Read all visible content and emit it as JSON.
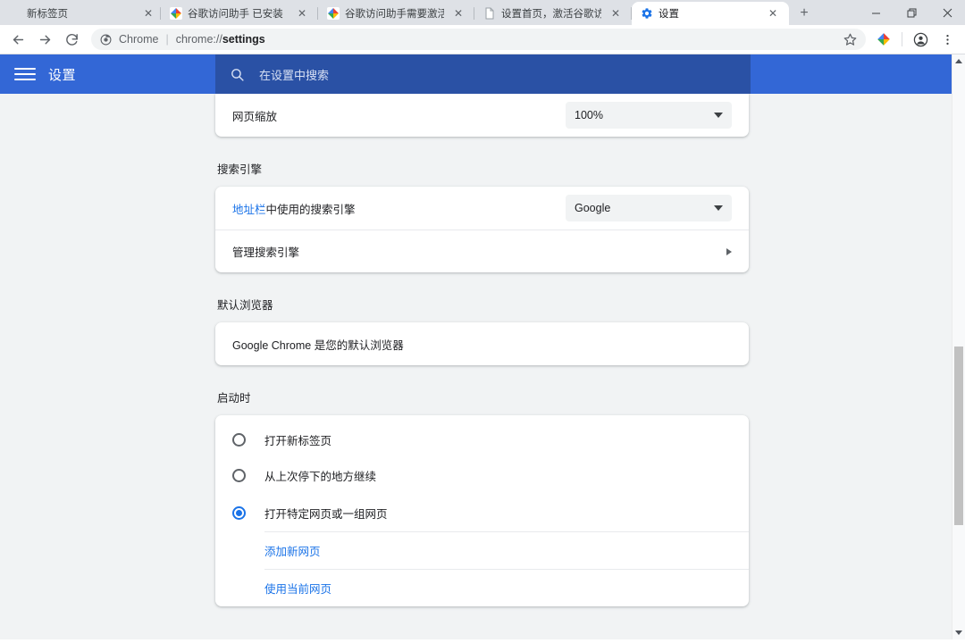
{
  "browser": {
    "tabs": [
      {
        "title": "新标签页",
        "favicon": "none",
        "active": false
      },
      {
        "title": "谷歌访问助手 已安装",
        "favicon": "google-pinwheel",
        "active": false
      },
      {
        "title": "谷歌访问助手需要激活",
        "favicon": "google-pinwheel",
        "active": false
      },
      {
        "title": "设置首页，激活谷歌访问⋯",
        "favicon": "page-icon",
        "active": false
      },
      {
        "title": "设置",
        "favicon": "gear-icon",
        "active": true
      }
    ],
    "new_tab_label": "+",
    "close_label": "✕",
    "window_controls": {
      "minimize": "—",
      "maximize": "❐",
      "close": "✕"
    },
    "omnibox": {
      "scheme_label": "Chrome",
      "separator": "|",
      "url_prefix": "chrome://",
      "url_bold": "settings"
    },
    "toolbar_icons": {
      "back": "back-arrow-icon",
      "forward": "forward-arrow-icon",
      "reload": "reload-icon",
      "site_info": "chrome-info-icon",
      "bookmark": "star-icon",
      "extension": "google-pinwheel-extension-icon",
      "profile": "profile-avatar-icon",
      "menu": "three-dot-menu-icon"
    }
  },
  "settings": {
    "header": {
      "menu_icon": "hamburger-icon",
      "title": "设置",
      "search_icon": "search-icon",
      "search_placeholder": "在设置中搜索",
      "search_value": ""
    },
    "appearance_partial": {
      "zoom_label": "网页缩放",
      "zoom_value": "100%"
    },
    "search_engine": {
      "section_title": "搜索引擎",
      "default_label_link": "地址栏",
      "default_label_rest": "中使用的搜索引擎",
      "default_value": "Google",
      "manage_label": "管理搜索引擎"
    },
    "default_browser": {
      "section_title": "默认浏览器",
      "status_text": "Google Chrome 是您的默认浏览器"
    },
    "on_startup": {
      "section_title": "启动时",
      "options": [
        {
          "label": "打开新标签页",
          "selected": false
        },
        {
          "label": "从上次停下的地方继续",
          "selected": false
        },
        {
          "label": "打开特定网页或一组网页",
          "selected": true
        }
      ],
      "add_page_label": "添加新网页",
      "use_current_label": "使用当前网页"
    },
    "colors": {
      "header_blue": "#3367d6",
      "search_blue": "#2a51a5",
      "link_blue": "#1a73e8",
      "page_bg": "#f1f3f4",
      "card_bg": "#ffffff"
    },
    "scrollbar": {
      "up_arrow": "scroll-up-arrow-icon",
      "down_arrow": "scroll-down-arrow-icon"
    }
  }
}
